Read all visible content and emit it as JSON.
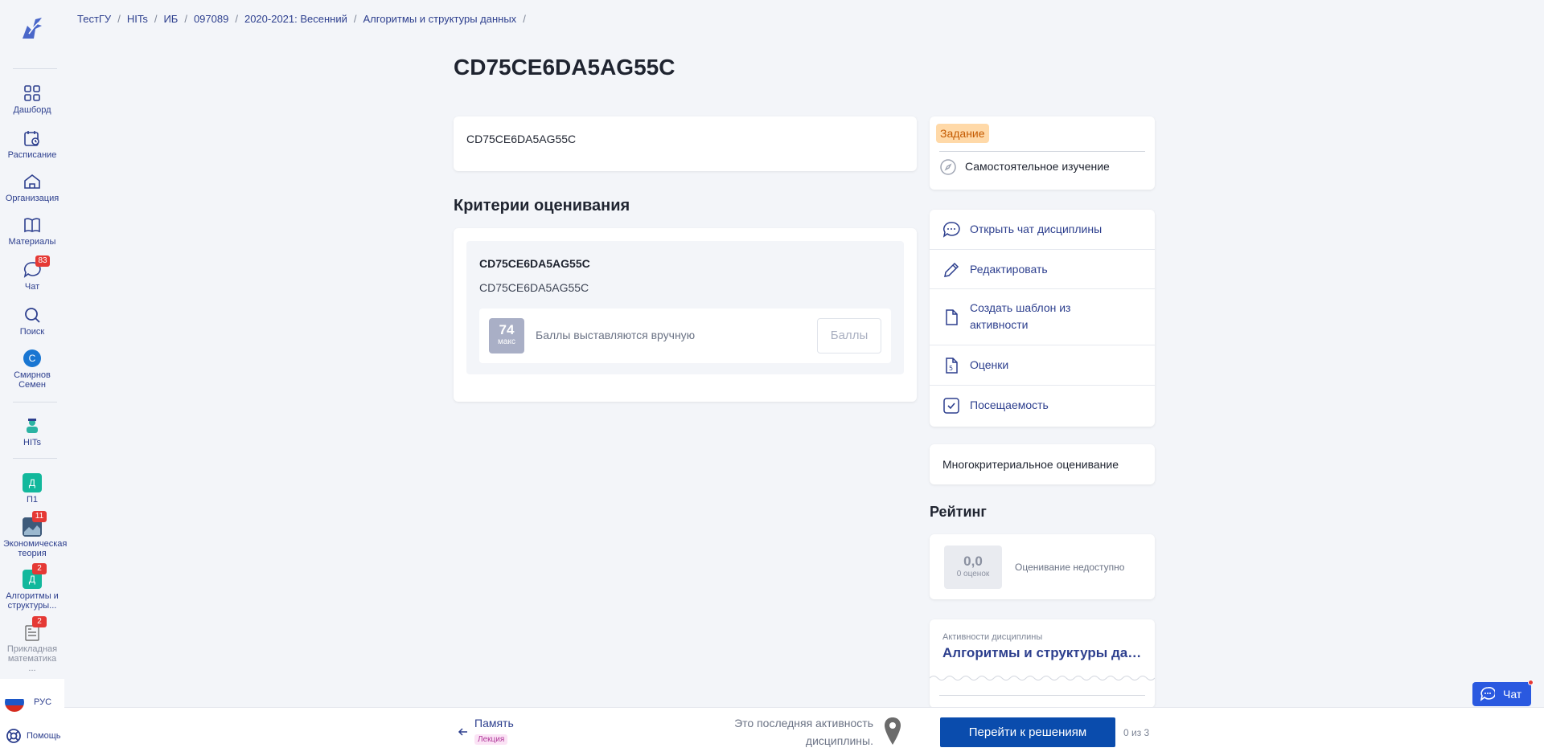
{
  "sidebar": {
    "items": [
      {
        "label": "Дашборд",
        "icon": "grid-icon"
      },
      {
        "label": "Расписание",
        "icon": "calendar-icon"
      },
      {
        "label": "Организация",
        "icon": "home-icon"
      },
      {
        "label": "Материалы",
        "icon": "book-icon"
      },
      {
        "label": "Чат",
        "icon": "chat-icon",
        "badge": "83"
      },
      {
        "label": "Поиск",
        "icon": "search-icon"
      }
    ],
    "user": {
      "initial": "С",
      "name": "Смирнов Семен"
    },
    "org": {
      "label": "HITs"
    },
    "courses": [
      {
        "letter": "Д",
        "label": "П1",
        "color": "#12b89c"
      },
      {
        "label": "Экономическая теория",
        "badge": "11"
      },
      {
        "letter": "Д",
        "label": "Алгоритмы и структуры...",
        "badge": "2",
        "color": "#12b89c"
      },
      {
        "label": "Прикладная математика ...",
        "badge": "2"
      }
    ],
    "language": "РУС",
    "help": "Помощь"
  },
  "breadcrumb": [
    "ТестГУ",
    "HITs",
    "ИБ",
    "097089",
    "2020-2021: Весенний",
    "Алгоритмы и структуры данных"
  ],
  "page": {
    "title": "CD75CE6DA5AG55C",
    "description": "CD75CE6DA5AG55C"
  },
  "criteria": {
    "section_title": "Критерии оценивания",
    "name": "CD75CE6DA5AG55C",
    "description": "CD75CE6DA5AG55C",
    "max_value": "74",
    "max_label": "макс",
    "manual_text": "Баллы выставляются вручную",
    "score_placeholder": "Баллы"
  },
  "task": {
    "badge": "Задание",
    "type": "Самостоятельное изучение"
  },
  "actions": [
    {
      "label": "Открыть чат дисциплины",
      "icon": "chat-icon"
    },
    {
      "label": "Редактировать",
      "icon": "pencil-icon"
    },
    {
      "label": "Создать шаблон из активности",
      "icon": "document-icon"
    },
    {
      "label": "Оценки",
      "icon": "grade-icon"
    },
    {
      "label": "Посещаемость",
      "icon": "checkbox-icon"
    }
  ],
  "multi_criteria": "Многокритериальное оценивание",
  "rating": {
    "section_title": "Рейтинг",
    "value": "0,0",
    "count": "0 оценок",
    "status": "Оценивание недоступно"
  },
  "discipline": {
    "caption": "Активности дисциплины",
    "name": "Алгоритмы и структуры данных"
  },
  "bottom": {
    "prev_title": "Память",
    "prev_tag": "Лекция",
    "last_note": "Это последняя активность дисциплины.",
    "go_button": "Перейти к решениям",
    "count": "0 из 3"
  },
  "chat_button": "Чат",
  "colors": {
    "accent": "#2d3f8e",
    "primary_button": "#0a4cad",
    "task_badge": "#ffd9a8"
  }
}
